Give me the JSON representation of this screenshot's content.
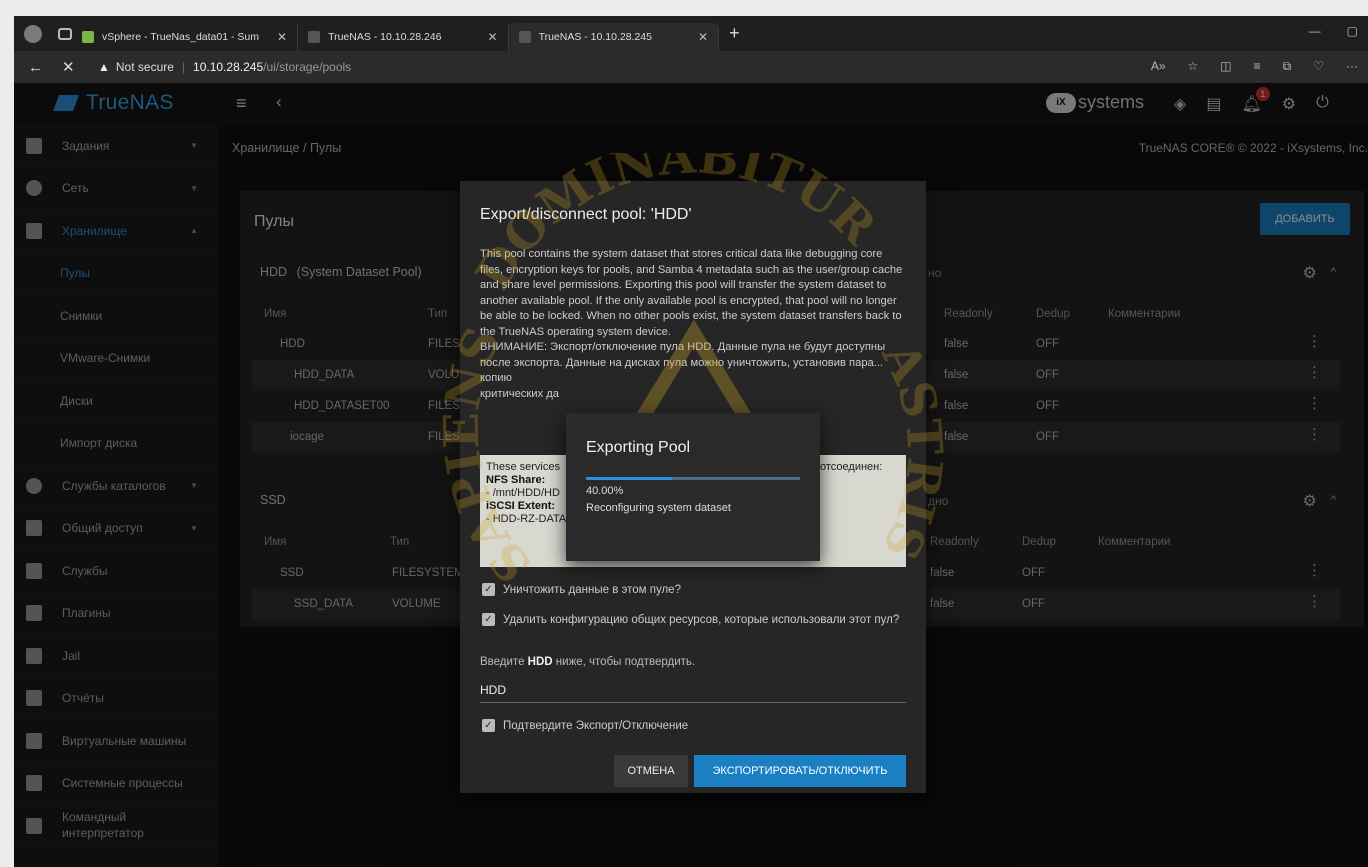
{
  "browser": {
    "tabs": [
      {
        "label": "vSphere - TrueNas_data01 - Sum",
        "favicon_color": "#7ab648"
      },
      {
        "label": "TrueNAS - 10.10.28.246",
        "favicon_color": "#555555"
      },
      {
        "label": "TrueNAS - 10.10.28.245",
        "favicon_color": "#555555"
      }
    ],
    "not_secure": "Not secure",
    "url_host": "10.10.28.245",
    "url_path": "/ui/storage/pools"
  },
  "header": {
    "logo_text": "TrueNAS",
    "vendor_badge": "iX",
    "vendor_text": "systems",
    "notification_count": "1"
  },
  "sidebar": {
    "items": [
      {
        "label": "Задания",
        "icon": "calendar-icon"
      },
      {
        "label": "Сеть",
        "icon": "network-icon"
      },
      {
        "label": "Хранилище",
        "icon": "storage-icon"
      },
      {
        "label": "Пулы"
      },
      {
        "label": "Снимки"
      },
      {
        "label": "VMware-Снимки"
      },
      {
        "label": "Диски"
      },
      {
        "label": "Импорт диска"
      },
      {
        "label": "Службы каталогов",
        "icon": "directory-icon"
      },
      {
        "label": "Общий доступ",
        "icon": "share-icon"
      },
      {
        "label": "Службы",
        "icon": "services-icon"
      },
      {
        "label": "Плагины",
        "icon": "plugin-icon"
      },
      {
        "label": "Jail",
        "icon": "jail-icon"
      },
      {
        "label": "Отчёты",
        "icon": "reports-icon"
      },
      {
        "label": "Виртуальные машины",
        "icon": "vm-icon"
      },
      {
        "label": "Системные процессы",
        "icon": "processes-icon"
      },
      {
        "label": "Командный интерпретатор",
        "icon": "shell-icon"
      }
    ]
  },
  "breadcrumb": {
    "parent": "Хранилище",
    "separator": "/",
    "current": "Пулы"
  },
  "copyright": "TrueNAS CORE® © 2022 - iXsystems, Inc.",
  "pools_card": {
    "title": "Пулы",
    "add_label": "ДОБАВИТЬ",
    "pools": [
      {
        "name": "HDD",
        "subtitle": "(System Dataset Pool)",
        "status_fragment": "но",
        "columns": [
          "Имя",
          "Тип",
          "Readonly",
          "Dedup",
          "Комментарии"
        ],
        "rows": [
          {
            "name": "HDD",
            "type": "FILES",
            "readonly": "false",
            "dedup": "OFF"
          },
          {
            "name": "HDD_DATA",
            "type": "VOLU",
            "readonly": "false",
            "dedup": "OFF"
          },
          {
            "name": "HDD_DATASET00",
            "type": "FILES",
            "readonly": "false",
            "dedup": "OFF"
          },
          {
            "name": "iocage",
            "type": "FILES",
            "readonly": "false",
            "dedup": "OFF"
          }
        ]
      },
      {
        "name": "SSD",
        "subtitle": "",
        "status_fragment": "дно",
        "columns": [
          "Имя",
          "Тип",
          "Readonly",
          "Dedup",
          "Комментарии"
        ],
        "rows": [
          {
            "name": "SSD",
            "type": "FILESYSTEM",
            "readonly": "false",
            "dedup": "OFF"
          },
          {
            "name": "SSD_DATA",
            "type": "VOLUME",
            "readonly": "false",
            "dedup": "OFF"
          }
        ]
      }
    ]
  },
  "export_dialog": {
    "title": "Export/disconnect pool: 'HDD'",
    "body": "This pool contains the system dataset that stores critical data like debugging core files, encryption keys for pools, and Samba 4 metadata such as the user/group cache and share level permissions. Exporting this pool will transfer the system dataset to another available pool. If the only available pool is encrypted, that pool will no longer be able to be locked. When no other pools exist, the system dataset transfers back to the TrueNAS operating system device.",
    "warning": "ВНИМАНИЕ: Экспорт/отключение пула HDD. Данные пула не будут доступны после экспорта. Данные на дисках пула можно уничтожить, установив пара...",
    "warning_tail": "критических да",
    "warning_right": "копию",
    "services_intro": "These services",
    "services_intro_tail": "отсоединен:",
    "nfs_label": "NFS Share:",
    "nfs_value": "- /mnt/HDD/HD",
    "iscsi_label": "iSCSI Extent:",
    "iscsi_value": "- HDD-RZ-DATA0",
    "destroy_label": "Уничтожить данные в этом пуле?",
    "delete_config_label": "Удалить конфигурацию общих ресурсов, которые использовали этот пул?",
    "prompt_prefix": "Введите",
    "prompt_pool": "HDD",
    "prompt_suffix": "ниже, чтобы подтвердить.",
    "input_value": "HDD",
    "confirm_label": "Подтвердите Экспорт/Отключение",
    "cancel_label": "ОТМЕНА",
    "export_label": "ЭКСПОРТИРОВАТЬ/ОТКЛЮЧИТЬ"
  },
  "progress_dialog": {
    "title": "Exporting Pool",
    "percent_text": "40.00%",
    "percent": 40,
    "message": "Reconfiguring system dataset"
  },
  "watermark": {
    "top_text": "DOMINABITUR",
    "left_text": "SAPIENS",
    "right_text": "ASTRIS"
  },
  "colors": {
    "accent": "#1b7fc4",
    "active_nav": "#3a8fd6",
    "watermark": "#c9a227"
  }
}
